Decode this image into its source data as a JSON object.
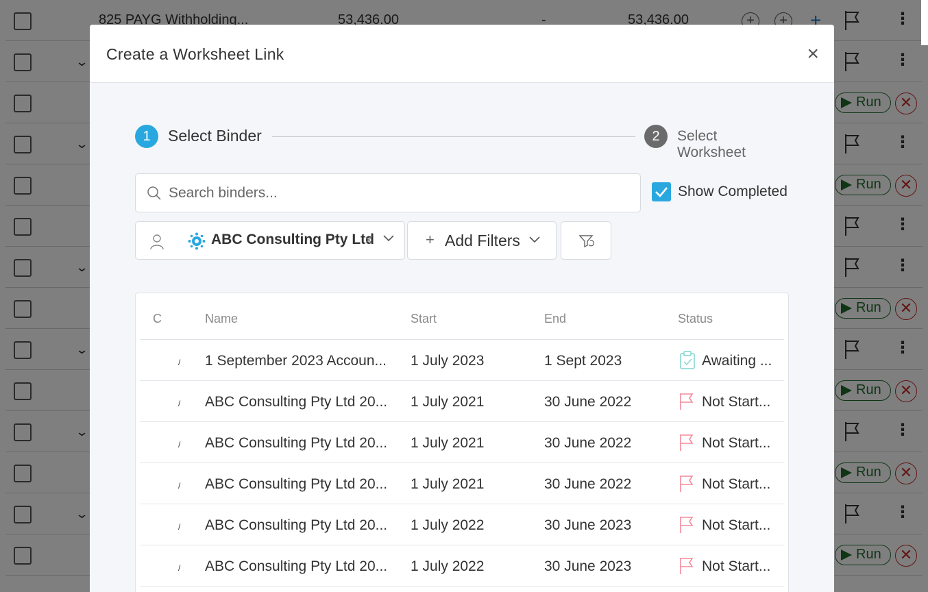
{
  "background": {
    "top_row": {
      "name": "825 PAYG Withholding...",
      "amount1": "53,436.00",
      "dash": "-",
      "amount2": "53,436.00"
    },
    "run_label": "Run"
  },
  "modal": {
    "title": "Create a Worksheet Link",
    "close_label": "×",
    "steps": [
      {
        "number": "1",
        "label": "Select Binder"
      },
      {
        "number": "2",
        "label": "Select Worksheet"
      }
    ],
    "search": {
      "placeholder": "Search binders...",
      "value": ""
    },
    "show_completed": {
      "label": "Show Completed",
      "checked": true
    },
    "client_filter": {
      "value": "ABC Consulting Pty Ltd",
      "clear": "×"
    },
    "add_filters_label": "Add Filters",
    "table": {
      "columns": [
        "C",
        "Name",
        "Start",
        "End",
        "Status"
      ],
      "rows": [
        {
          "c": "/",
          "name": "1 September 2023 Accoun...",
          "start": "1 July 2023",
          "end": "1 Sept 2023",
          "status": "Awaiting ...",
          "status_icon": "clipboard-icon"
        },
        {
          "c": "/",
          "name": "ABC Consulting Pty Ltd 20...",
          "start": "1 July 2021",
          "end": "30 June 2022",
          "status": "Not Start...",
          "status_icon": "flag-icon"
        },
        {
          "c": "/",
          "name": "ABC Consulting Pty Ltd 20...",
          "start": "1 July 2021",
          "end": "30 June 2022",
          "status": "Not Start...",
          "status_icon": "flag-icon"
        },
        {
          "c": "/",
          "name": "ABC Consulting Pty Ltd 20...",
          "start": "1 July 2021",
          "end": "30 June 2022",
          "status": "Not Start...",
          "status_icon": "flag-icon"
        },
        {
          "c": "/",
          "name": "ABC Consulting Pty Ltd 20...",
          "start": "1 July 2022",
          "end": "30 June 2023",
          "status": "Not Start...",
          "status_icon": "flag-icon"
        },
        {
          "c": "/",
          "name": "ABC Consulting Pty Ltd 20...",
          "start": "1 July 2022",
          "end": "30 June 2023",
          "status": "Not Start...",
          "status_icon": "flag-icon"
        }
      ]
    }
  },
  "colors": {
    "accent": "#29a8e0",
    "flag_pink": "#f28b9b",
    "clipboard_teal": "#7fd6d0",
    "run_green": "#1f6b2b",
    "danger_red": "#c62828"
  }
}
